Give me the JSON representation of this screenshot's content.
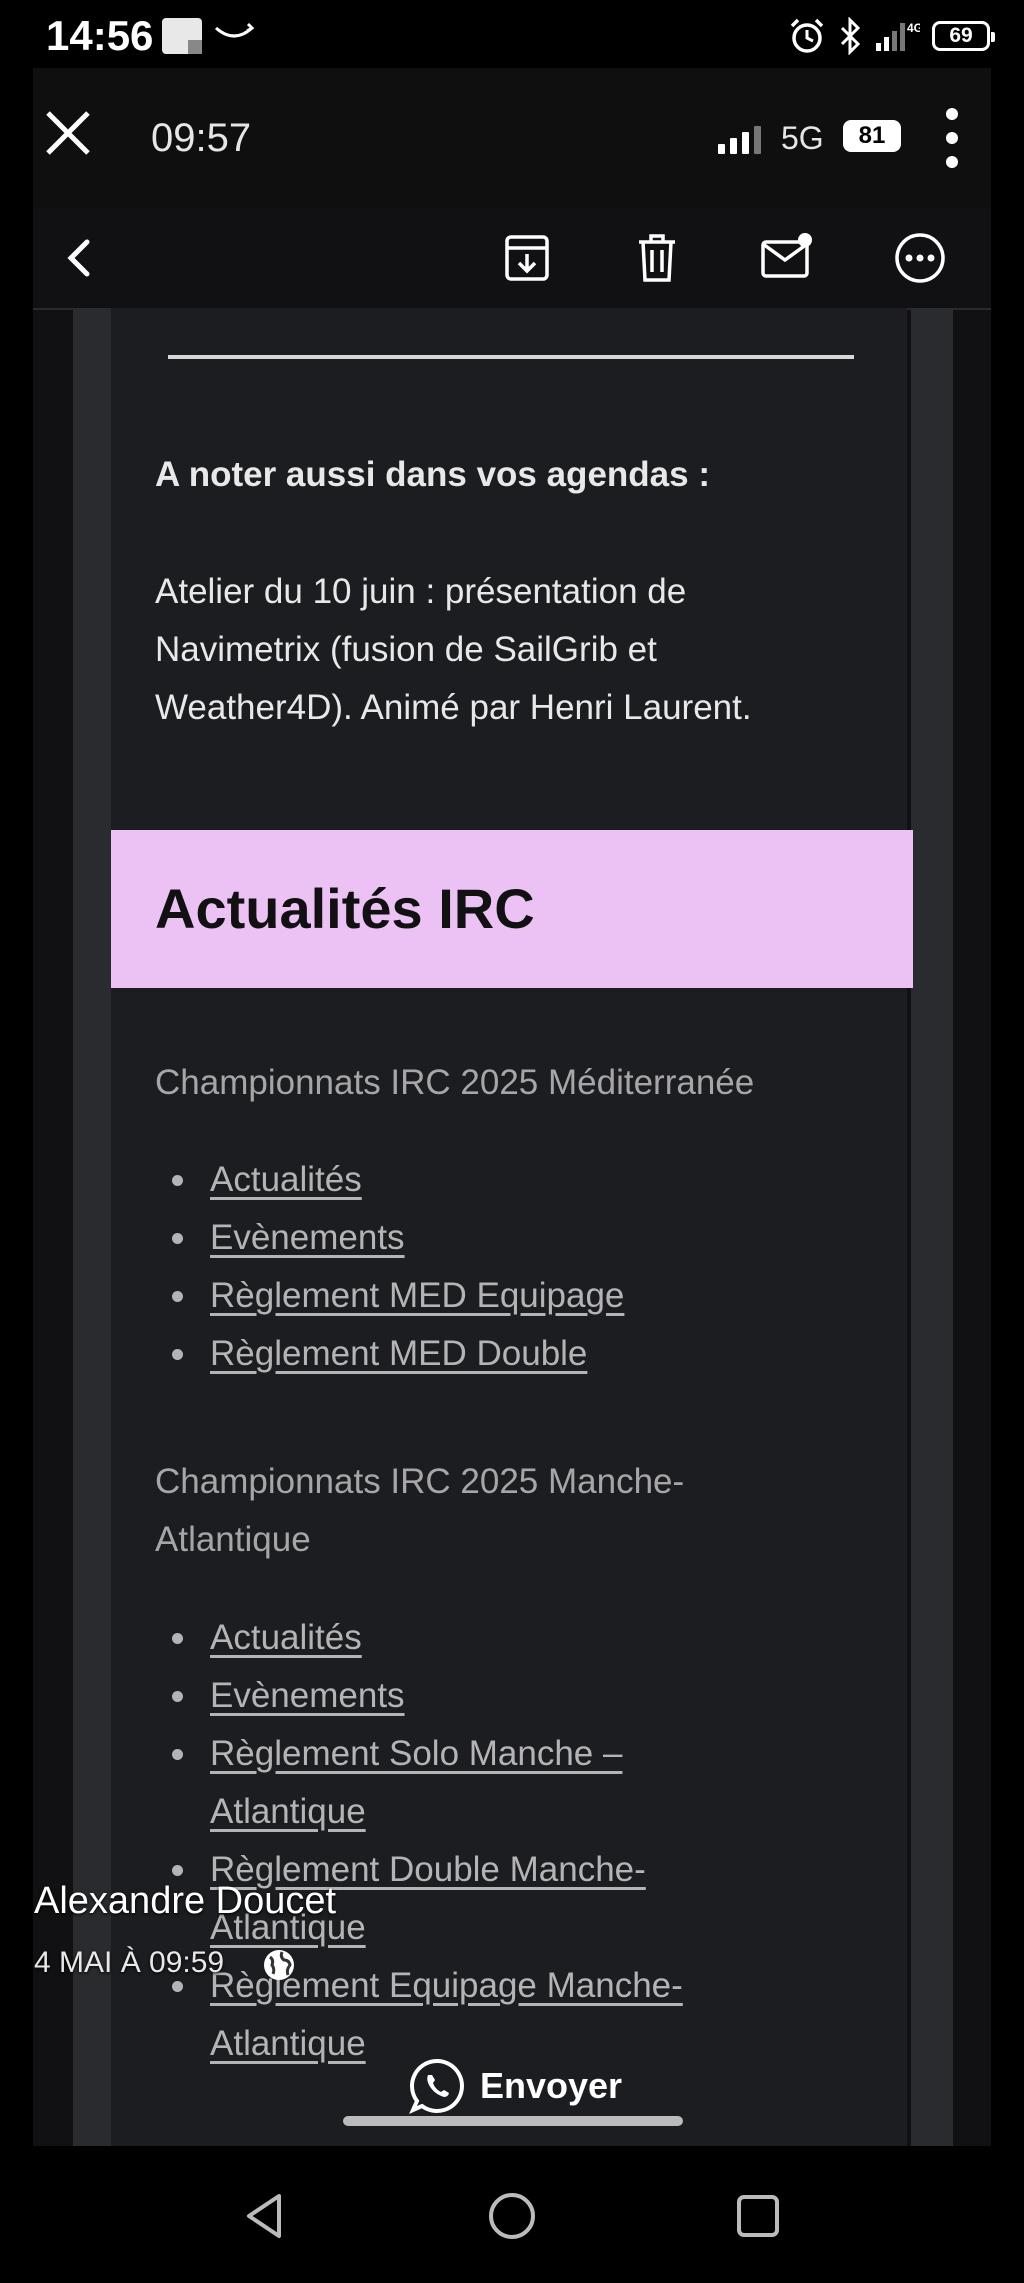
{
  "device_status": {
    "time": "14:56",
    "network": "4G",
    "battery": "69",
    "icons": [
      "note-icon",
      "smile-icon",
      "alarm-icon",
      "bluetooth-icon",
      "signal-icon",
      "battery-icon"
    ]
  },
  "inner_status": {
    "time": "09:57",
    "network": "5G",
    "battery": "81"
  },
  "toolbar": {
    "icons": [
      "back-icon",
      "archive-icon",
      "trash-icon",
      "mail-unread-icon",
      "more-icon"
    ]
  },
  "email": {
    "agenda_heading": "A noter aussi dans vos agendas :",
    "agenda_lines": [
      "Atelier du 10 juin : présentation de",
      "Navimetrix (fusion de SailGrib et",
      "Weather4D). Animé par Henri Laurent."
    ],
    "banner_title": "Actualités IRC",
    "banner_color": "#ecc2f5",
    "section1": {
      "title": "Championnats IRC 2025 Méditerranée",
      "links": [
        "Actualités",
        "Evènements",
        "Règlement MED Equipage",
        "Règlement MED Double"
      ]
    },
    "section2": {
      "title_lines": [
        "Championnats IRC 2025 Manche-",
        "Atlantique"
      ],
      "links": [
        [
          "Actualités"
        ],
        [
          "Evènements"
        ],
        [
          "Règlement Solo Manche –",
          "Atlantique"
        ],
        [
          "Règlement Double Manche-",
          "Atlantique"
        ],
        [
          "Règlement Equipage Manche-",
          "Atlantique"
        ]
      ]
    }
  },
  "overlay": {
    "author": "Alexandre Doucet",
    "date": "4 MAI À 09:59",
    "send_label": "Envoyer"
  },
  "nav": {
    "icons": [
      "nav-back-icon",
      "nav-home-icon",
      "nav-recents-icon"
    ]
  }
}
